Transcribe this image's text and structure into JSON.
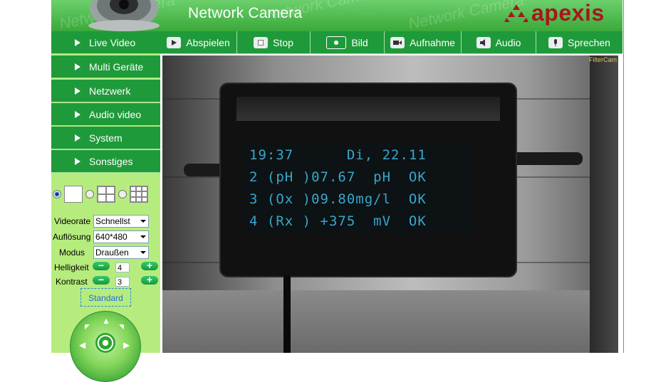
{
  "header": {
    "title": "Network Camera",
    "brand": "apexis",
    "brand_color": "#a8161c",
    "watermark": "Network Camera"
  },
  "sidebar": {
    "items": [
      {
        "label": "Live Video"
      },
      {
        "label": "Multi Geräte"
      },
      {
        "label": "Netzwerk"
      },
      {
        "label": "Audio video"
      },
      {
        "label": "System"
      },
      {
        "label": "Sonstiges"
      }
    ]
  },
  "controls": {
    "videorate": {
      "label": "Videorate",
      "value": "Schnellst"
    },
    "resolution": {
      "label": "Auflösung",
      "value": "640*480"
    },
    "mode": {
      "label": "Modus",
      "value": "Draußen"
    },
    "brightness": {
      "label": "Helligkeit",
      "value": "4"
    },
    "contrast": {
      "label": "Kontrast",
      "value": "3"
    },
    "minus": "−",
    "plus": "+",
    "standard": "Standard"
  },
  "toolbar": {
    "buttons": [
      {
        "label": "Abspielen",
        "icon": "play-icon"
      },
      {
        "label": "Stop",
        "icon": "stop-icon"
      },
      {
        "label": "Bild",
        "icon": "camera-icon"
      },
      {
        "label": "Aufnahme",
        "icon": "video-camera-icon"
      },
      {
        "label": "Audio",
        "icon": "speaker-icon"
      },
      {
        "label": "Sprechen",
        "icon": "microphone-icon"
      }
    ]
  },
  "video": {
    "overlay": "FilterCam",
    "lcd_lines": [
      "19:37      Di, 22.11",
      "2 (pH )07.67  pH  OK",
      "3 (Ox )09.80mg/l  OK",
      "4 (Rx ) +375  mV  OK"
    ]
  },
  "colors": {
    "menu_green": "#1f9a3a",
    "sidebar_bg": "#b6ec7e",
    "header_green": "#4fbf4f",
    "lcd_text": "#39a6c9"
  }
}
